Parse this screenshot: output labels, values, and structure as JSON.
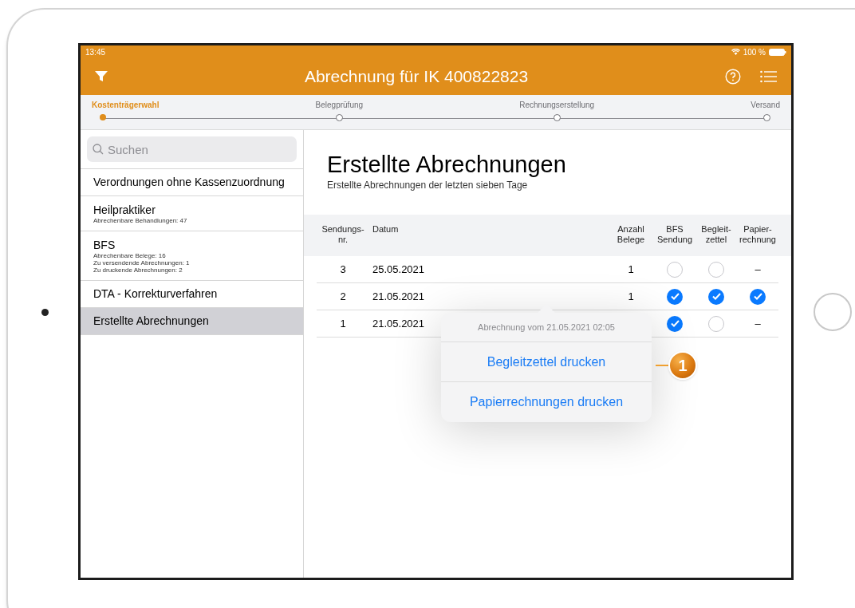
{
  "status_bar": {
    "time": "13:45",
    "battery": "100 %"
  },
  "nav_bar": {
    "title": "Abrechnung für IK 400822823"
  },
  "stepper": [
    {
      "label": "Kostenträgerwahl",
      "selected": true
    },
    {
      "label": "Belegprüfung",
      "selected": false
    },
    {
      "label": "Rechnungserstellung",
      "selected": false
    },
    {
      "label": "Versand",
      "selected": false
    }
  ],
  "sidebar": {
    "search": {
      "placeholder": "Suchen"
    },
    "items": [
      {
        "title": "Verordnungen ohne Kassenzuordnung",
        "selected": false
      },
      {
        "title": "Heilpraktiker",
        "details": [
          "Abrechenbare Behandlungen: 47"
        ],
        "selected": false
      },
      {
        "title": "BFS",
        "details": [
          "Abrechenbare Belege: 16",
          "Zu versendende Abrechnungen: 1",
          "Zu druckende Abrechnungen: 2"
        ],
        "selected": false
      },
      {
        "title": "DTA - Korrekturverfahren",
        "selected": false
      },
      {
        "title": "Erstellte Abrechnungen",
        "selected": true
      }
    ]
  },
  "content": {
    "title": "Erstellte Abrechnungen",
    "subtitle": "Erstellte Abrechnungen der letzten sieben Tage"
  },
  "table": {
    "columns": [
      "Sendungs-\nnr.",
      "Datum",
      "Anzahl\nBelege",
      "BFS\nSendung",
      "Begleit-\nzettel",
      "Papier-\nrechnung"
    ],
    "rows": [
      {
        "number": "3",
        "date": "25.05.2021",
        "count": "1",
        "status": [
          {
            "kind": "check",
            "checked": false
          },
          {
            "kind": "check",
            "checked": false
          },
          {
            "kind": "dash",
            "text": "–"
          }
        ]
      },
      {
        "number": "2",
        "date": "21.05.2021",
        "count": "1",
        "status": [
          {
            "kind": "check",
            "checked": true
          },
          {
            "kind": "check",
            "checked": true
          },
          {
            "kind": "check",
            "checked": true
          }
        ]
      },
      {
        "number": "1",
        "date": "21.05.2021",
        "status": [
          {
            "kind": "check",
            "checked": true
          },
          {
            "kind": "check",
            "checked": false
          },
          {
            "kind": "dash",
            "text": "–"
          }
        ]
      }
    ]
  },
  "popover": {
    "title": "Abrechnung vom 21.05.2021 02:05",
    "actions": [
      "Begleitzettel drucken",
      "Papierrechnungen drucken"
    ]
  },
  "callout": {
    "label": "1"
  }
}
